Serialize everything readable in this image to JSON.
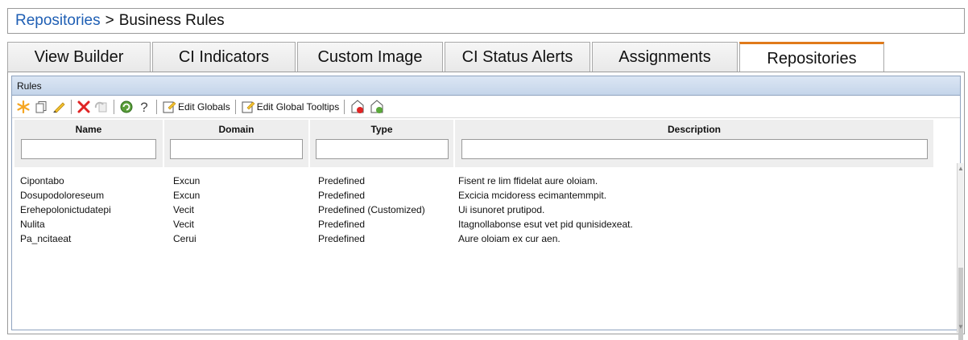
{
  "breadcrumb": {
    "link": "Repositories",
    "separator": ">",
    "current": "Business Rules"
  },
  "tabs": [
    {
      "label": "View Builder",
      "active": false
    },
    {
      "label": "CI Indicators",
      "active": false
    },
    {
      "label": "Custom Image",
      "active": false
    },
    {
      "label": "CI Status Alerts",
      "active": false
    },
    {
      "label": "Assignments",
      "active": false
    },
    {
      "label": "Repositories",
      "active": true
    }
  ],
  "panel": {
    "title": "Rules"
  },
  "toolbar": {
    "icons": [
      "new-icon",
      "copy-icon",
      "edit-icon",
      "delete-icon",
      "restore-icon",
      "refresh-icon",
      "help-icon"
    ],
    "edit_globals_label": "Edit Globals",
    "edit_global_tooltips_label": "Edit Global Tooltips",
    "accent_delete": "#e02424",
    "accent_new": "#f5a623"
  },
  "table": {
    "columns": [
      "Name",
      "Domain",
      "Type",
      "Description"
    ],
    "filters": [
      "",
      "",
      "",
      ""
    ],
    "rows": [
      {
        "name": "Cipontabo",
        "domain": "Excun",
        "type": "Predefined",
        "description": "Fisent re lim ffidelat aure oloiam."
      },
      {
        "name": "Dosupodoloreseum",
        "domain": "Excun",
        "type": "Predefined",
        "description": "Excicia mcidoress ecimantemmpit."
      },
      {
        "name": "Erehepolonictudatepi",
        "domain": "Vecit",
        "type": "Predefined (Customized)",
        "description": "Ui isunoret prutipod."
      },
      {
        "name": "Nulita",
        "domain": "Vecit",
        "type": "Predefined",
        "description": "Itagnollabonse esut vet pid qunisidexeat."
      },
      {
        "name": "Pa_ncitaeat",
        "domain": "Cerui",
        "type": "Predefined",
        "description": "Aure oloiam ex cur aen."
      }
    ]
  }
}
